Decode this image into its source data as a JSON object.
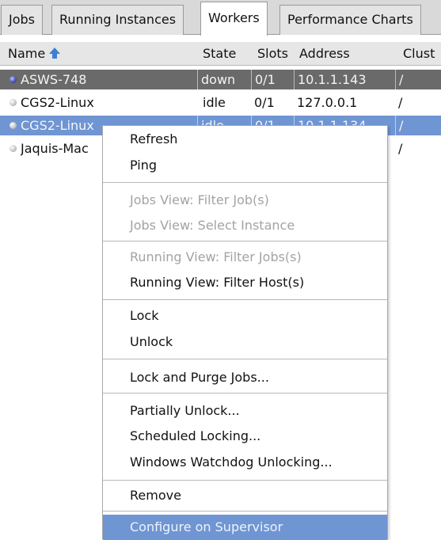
{
  "tabs": [
    {
      "label": "Jobs"
    },
    {
      "label": "Running Instances"
    },
    {
      "label": "Workers"
    },
    {
      "label": "Performance Charts"
    }
  ],
  "table": {
    "columns": [
      "Name",
      "State",
      "Slots",
      "Address",
      "Clust"
    ],
    "rows": [
      {
        "name": "ASWS-748",
        "state": "down",
        "slots": "0/1",
        "address": "10.1.1.143",
        "cluster": "/"
      },
      {
        "name": "CGS2-Linux",
        "state": "idle",
        "slots": "0/1",
        "address": "127.0.0.1",
        "cluster": "/"
      },
      {
        "name": "CGS2-Linux",
        "state": "idle",
        "slots": "0/1",
        "address": "10.1.1.134",
        "cluster": "/"
      },
      {
        "name": "Jaquis-Mac",
        "state": "",
        "slots": "",
        "address": "",
        "cluster": "/"
      }
    ]
  },
  "colors": {
    "selection_blue": "#6f95d3",
    "selection_dark": "#6a6a6a",
    "sort_arrow": "#3f7fd0"
  },
  "context_menu": {
    "groups": [
      [
        {
          "label": "Refresh",
          "enabled": true
        },
        {
          "label": "Ping",
          "enabled": true
        }
      ],
      [
        {
          "label": "Jobs View: Filter Job(s)",
          "enabled": false
        },
        {
          "label": "Jobs View: Select Instance",
          "enabled": false
        }
      ],
      [
        {
          "label": "Running View: Filter Jobs(s)",
          "enabled": false
        },
        {
          "label": "Running View: Filter Host(s)",
          "enabled": true
        }
      ],
      [
        {
          "label": "Lock",
          "enabled": true
        },
        {
          "label": "Unlock",
          "enabled": true
        }
      ],
      [
        {
          "label": "Lock and Purge Jobs...",
          "enabled": true
        }
      ],
      [
        {
          "label": "Partially Unlock...",
          "enabled": true
        },
        {
          "label": "Scheduled Locking...",
          "enabled": true
        },
        {
          "label": "Windows Watchdog Unlocking...",
          "enabled": true
        }
      ],
      [
        {
          "label": "Remove",
          "enabled": true
        }
      ],
      [
        {
          "label": "Configure on Supervisor",
          "enabled": true,
          "highlighted": true
        }
      ]
    ]
  }
}
